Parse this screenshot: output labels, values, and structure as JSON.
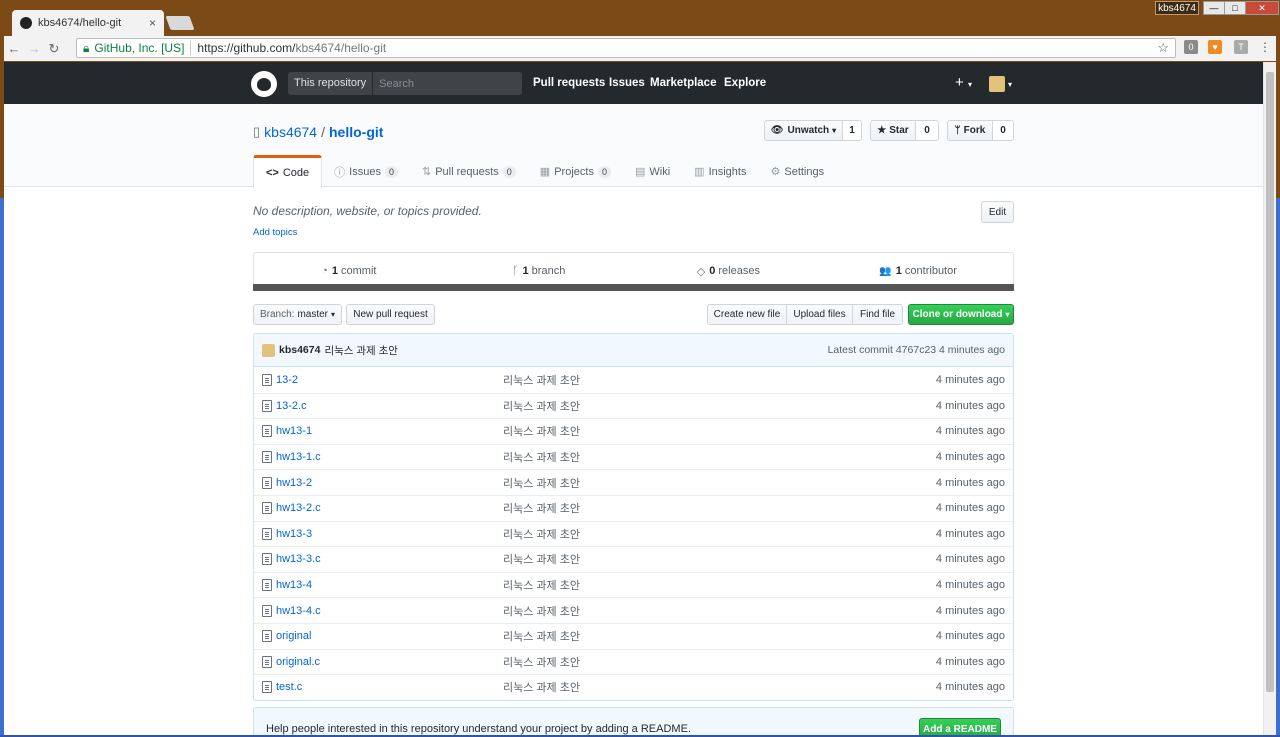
{
  "browser": {
    "tab_title": "kbs4674/hello-git",
    "tab_close": "×",
    "user_chip": "kbs4674",
    "window_buttons": {
      "minimize": "—",
      "maximize": "□",
      "close": "✕"
    },
    "nav": {
      "back": "←",
      "forward": "→",
      "reload": "↻"
    },
    "secure_label": "GitHub, Inc. [US]",
    "url_host": "https://github.com/",
    "url_path": "kbs4674/hello-git",
    "bookmark_star": "☆",
    "extensions": [
      "0",
      "♥",
      "T",
      "⋮"
    ]
  },
  "header": {
    "scope_label": "This repository",
    "search_placeholder": "Search",
    "nav": [
      "Pull requests",
      "Issues",
      "Marketplace",
      "Explore"
    ],
    "plus": "+",
    "caret": "▾"
  },
  "repo": {
    "owner": "kbs4674",
    "slash": "/",
    "name": "hello-git",
    "watch_label": "Unwatch",
    "watch_count": "1",
    "star_label": "Star",
    "star_count": "0",
    "fork_label": "Fork",
    "fork_count": "0"
  },
  "tabs": [
    {
      "label": "Code",
      "icon": "<>",
      "badge": ""
    },
    {
      "label": "Issues",
      "icon": "ⓘ",
      "badge": "0"
    },
    {
      "label": "Pull requests",
      "icon": "⇅",
      "badge": "0"
    },
    {
      "label": "Projects",
      "icon": "▦",
      "badge": "0"
    },
    {
      "label": "Wiki",
      "icon": "▤",
      "badge": ""
    },
    {
      "label": "Insights",
      "icon": "▥",
      "badge": ""
    },
    {
      "label": "Settings",
      "icon": "⚙",
      "badge": ""
    }
  ],
  "summary": {
    "description": "No description, website, or topics provided.",
    "add_topics": "Add topics",
    "edit_label": "Edit"
  },
  "numbers": [
    {
      "count": "1",
      "label": "commit",
      "icon": "◔"
    },
    {
      "count": "1",
      "label": "branch",
      "icon": "ᚴ"
    },
    {
      "count": "0",
      "label": "releases",
      "icon": "◇"
    },
    {
      "count": "1",
      "label": "contributor",
      "icon": "👥"
    }
  ],
  "file_nav": {
    "branch_prefix": "Branch:",
    "branch_name": "master",
    "new_pr": "New pull request",
    "create_file": "Create new file",
    "upload_files": "Upload files",
    "find_file": "Find file",
    "clone": "Clone or download"
  },
  "commit": {
    "author": "kbs4674",
    "message": "리눅스 과제 초안",
    "latest": "Latest commit 4767c23 4 minutes ago"
  },
  "files": [
    {
      "name": "13-2",
      "message": "리눅스 과제 초안",
      "age": "4 minutes ago"
    },
    {
      "name": "13-2.c",
      "message": "리눅스 과제 초안",
      "age": "4 minutes ago"
    },
    {
      "name": "hw13-1",
      "message": "리눅스 과제 초안",
      "age": "4 minutes ago"
    },
    {
      "name": "hw13-1.c",
      "message": "리눅스 과제 초안",
      "age": "4 minutes ago"
    },
    {
      "name": "hw13-2",
      "message": "리눅스 과제 초안",
      "age": "4 minutes ago"
    },
    {
      "name": "hw13-2.c",
      "message": "리눅스 과제 초안",
      "age": "4 minutes ago"
    },
    {
      "name": "hw13-3",
      "message": "리눅스 과제 초안",
      "age": "4 minutes ago"
    },
    {
      "name": "hw13-3.c",
      "message": "리눅스 과제 초안",
      "age": "4 minutes ago"
    },
    {
      "name": "hw13-4",
      "message": "리눅스 과제 초안",
      "age": "4 minutes ago"
    },
    {
      "name": "hw13-4.c",
      "message": "리눅스 과제 초안",
      "age": "4 minutes ago"
    },
    {
      "name": "original",
      "message": "리눅스 과제 초안",
      "age": "4 minutes ago"
    },
    {
      "name": "original.c",
      "message": "리눅스 과제 초안",
      "age": "4 minutes ago"
    },
    {
      "name": "test.c",
      "message": "리눅스 과제 초안",
      "age": "4 minutes ago"
    }
  ],
  "readme": {
    "text": "Help people interested in this repository understand your project by adding a README.",
    "button": "Add a README"
  },
  "colors": {
    "accent": "#0366d6",
    "header": "#24292e",
    "green": "#28a745",
    "tab_highlight": "#e36209"
  }
}
